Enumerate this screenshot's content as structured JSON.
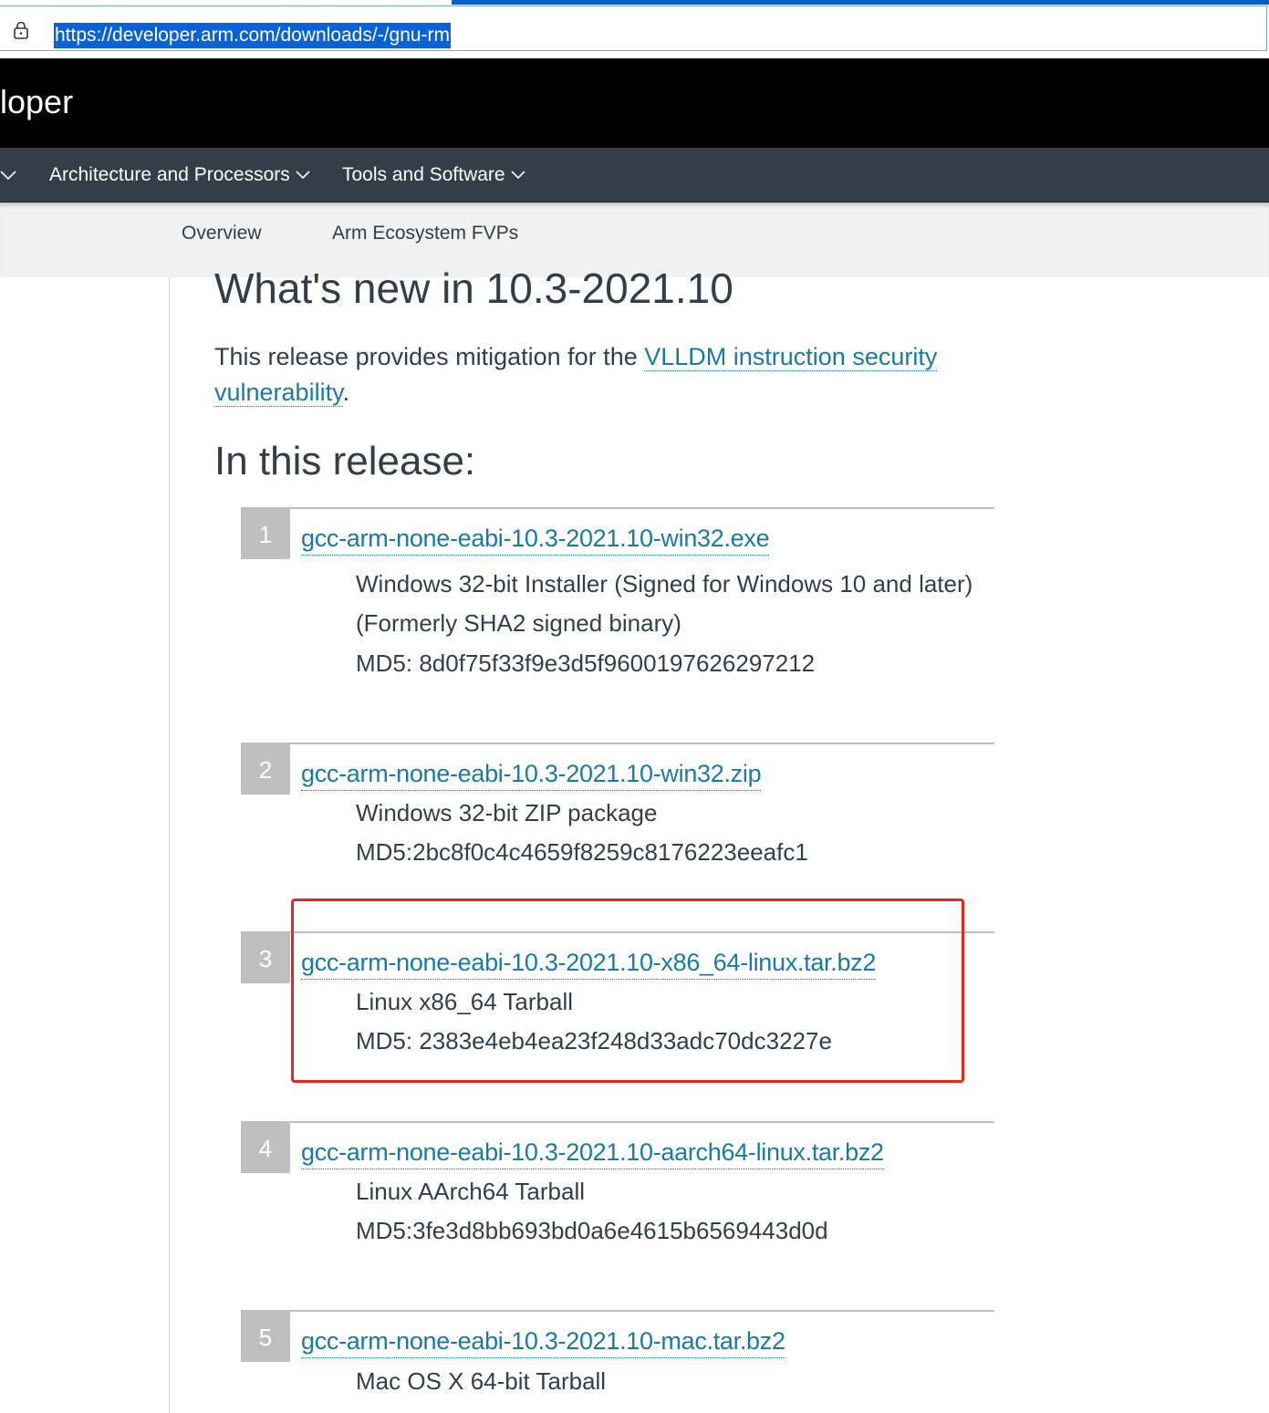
{
  "browser": {
    "url": "https://developer.arm.com/downloads/-/gnu-rm"
  },
  "header": {
    "brand": "loper"
  },
  "main_nav": {
    "items": [
      {
        "label": "Architecture and Processors"
      },
      {
        "label": "Tools and Software"
      }
    ]
  },
  "sub_nav": {
    "items": [
      {
        "label": "Overview"
      },
      {
        "label": "Arm Ecosystem FVPs"
      }
    ]
  },
  "content": {
    "title": "What's new in 10.3-2021.10",
    "intro_text": "This release provides mitigation for the ",
    "intro_link": "VLLDM instruction security vulnerability",
    "intro_end": ".",
    "section_title": "In this release:",
    "releases": [
      {
        "number": "1",
        "filename": "gcc-arm-none-eabi-10.3-2021.10-win32.exe",
        "description": "Windows 32-bit Installer (Signed for Windows 10 and later) (Formerly SHA2 signed binary)",
        "md5": "MD5: 8d0f75f33f9e3d5f9600197626297212"
      },
      {
        "number": "2",
        "filename": "gcc-arm-none-eabi-10.3-2021.10-win32.zip",
        "description": "Windows 32-bit ZIP package",
        "md5": "MD5:2bc8f0c4c4659f8259c8176223eeafc1"
      },
      {
        "number": "3",
        "filename": "gcc-arm-none-eabi-10.3-2021.10-x86_64-linux.tar.bz2",
        "description": "Linux x86_64 Tarball",
        "md5": "MD5: 2383e4eb4ea23f248d33adc70dc3227e"
      },
      {
        "number": "4",
        "filename": "gcc-arm-none-eabi-10.3-2021.10-aarch64-linux.tar.bz2",
        "description": "Linux AArch64 Tarball",
        "md5": "MD5:3fe3d8bb693bd0a6e4615b6569443d0d"
      },
      {
        "number": "5",
        "filename": "gcc-arm-none-eabi-10.3-2021.10-mac.tar.bz2",
        "description": "Mac OS X 64-bit Tarball",
        "md5": ""
      }
    ]
  },
  "colors": {
    "link": "#1b7aa3",
    "nav_bg": "#333e48",
    "highlight": "#e8261c",
    "url_selection": "#0a63d6"
  }
}
